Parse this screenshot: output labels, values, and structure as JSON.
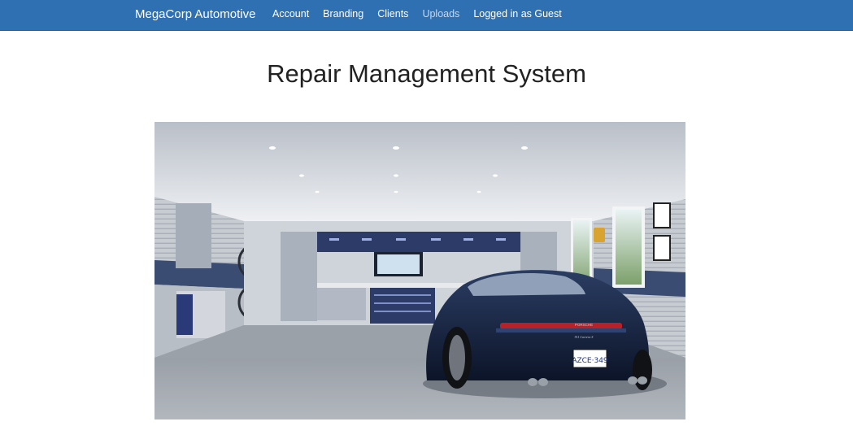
{
  "navbar": {
    "brand": "MegaCorp Automotive",
    "links": [
      {
        "label": "Account"
      },
      {
        "label": "Branding"
      },
      {
        "label": "Clients"
      },
      {
        "label": "Uploads"
      }
    ],
    "user_status": "Logged in as Guest",
    "background_color": "#2f70b3"
  },
  "page": {
    "title": "Repair Management System"
  },
  "hero": {
    "plate_text": "AZCE·349",
    "rear_badge": "PORSCHE",
    "model_badge": "911 Carrera S"
  }
}
